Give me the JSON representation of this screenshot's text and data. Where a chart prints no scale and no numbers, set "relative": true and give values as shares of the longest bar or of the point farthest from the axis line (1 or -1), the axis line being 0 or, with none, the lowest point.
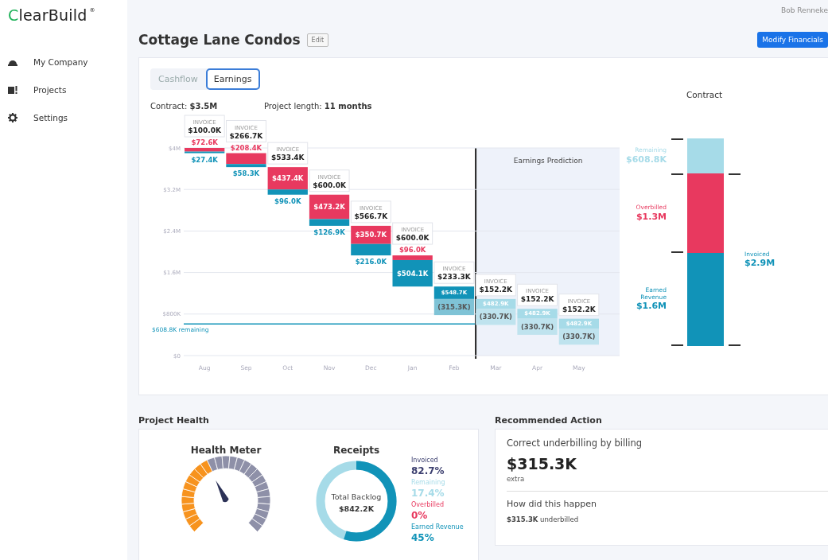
{
  "sidebar": {
    "logo": "ClearBuild",
    "logo_mark": "®",
    "items": [
      {
        "label": "My Company",
        "kind": "helmet"
      },
      {
        "label": "Projects",
        "kind": "alert"
      },
      {
        "label": "Settings",
        "kind": "gear"
      }
    ]
  },
  "header": {
    "user": "Bob Renneke",
    "title": "Cottage Lane Condos",
    "edit": "Edit",
    "action": "Modify Financials"
  },
  "earnings": {
    "tabs": [
      {
        "label": "Cashflow",
        "selected": false
      },
      {
        "label": "Earnings",
        "selected": true
      }
    ],
    "info": [
      "Contract: **$3.5M**",
      "Project length: **11 months**"
    ],
    "waterfall": {
      "y_labels": [
        "$4M",
        "$3.2M",
        "$2.4M",
        "$1.6M",
        "$800K",
        "$0"
      ],
      "prediction_label": "Earnings Prediction",
      "remaining_label": "$608.8K remaining",
      "months": [
        {
          "month": "Aug",
          "kind": "actual",
          "invoice_label": "INVOICE",
          "invoice": "$100.0K",
          "overbilled": "$72.6K",
          "earned": "$27.4K"
        },
        {
          "month": "Sep",
          "kind": "actual",
          "invoice_label": "INVOICE",
          "invoice": "$266.7K",
          "overbilled": "$208.4K",
          "earned": "$58.3K"
        },
        {
          "month": "Oct",
          "kind": "actual",
          "invoice_label": "INVOICE",
          "invoice": "$533.4K",
          "overbilled": "$437.4K",
          "earned": "$96.0K"
        },
        {
          "month": "Nov",
          "kind": "actual",
          "invoice_label": "INVOICE",
          "invoice": "$600.0K",
          "overbilled": "$473.2K",
          "earned": "$126.9K"
        },
        {
          "month": "Dec",
          "kind": "actual",
          "invoice_label": "INVOICE",
          "invoice": "$566.7K",
          "overbilled": "$350.7K",
          "earned": "$216.0K"
        },
        {
          "month": "Jan",
          "kind": "actual",
          "invoice_label": "INVOICE",
          "invoice": "$600.0K",
          "overbilled": "$96.0K",
          "earned": "$504.1K"
        },
        {
          "month": "Feb",
          "kind": "actual",
          "invoice_label": "INVOICE",
          "invoice": "$233.3K",
          "earned": "$548.7K",
          "underbilled": "(315.3K)"
        },
        {
          "month": "Mar",
          "kind": "predicted",
          "invoice_label": "INVOICE",
          "invoice": "$152.2K",
          "earned": "$482.9K",
          "underbilled": "(330.7K)"
        },
        {
          "month": "Apr",
          "kind": "predicted",
          "invoice_label": "INVOICE",
          "invoice": "$152.2K",
          "earned": "$482.9K",
          "underbilled": "(330.7K)"
        },
        {
          "month": "May",
          "kind": "predicted",
          "invoice_label": "INVOICE",
          "invoice": "$152.2K",
          "earned": "$482.9K",
          "underbilled": "(330.7K)"
        }
      ]
    },
    "contract": {
      "chart_data": {
        "type": "bar",
        "stacked": true,
        "relative": true,
        "title": "Contract",
        "series": [
          {
            "name": "Earned Revenue",
            "color": "#1193b8",
            "values": [
              0.45
            ]
          },
          {
            "name": "Overbilled",
            "color": "#e8395f",
            "values": [
              0.38
            ]
          },
          {
            "name": "Remaining",
            "color": "#a6dbe8",
            "values": [
              0.17
            ]
          }
        ],
        "value_labels": [
          [
            "$1.6M"
          ],
          [
            "$1.3M"
          ],
          [
            "$608.8K"
          ]
        ]
      },
      "invoiced": {
        "label": "Invoiced",
        "value": "$2.9M"
      }
    }
  },
  "health": {
    "title": "Project Health",
    "meter": {
      "title": "Health Meter"
    },
    "receipts": {
      "title": "Receipts",
      "center_label": "Total Backlog",
      "center_value": "$842.2K",
      "legend": [
        {
          "label": "Invoiced",
          "value": "82.7%",
          "color": "#3d4070"
        },
        {
          "label": "Remaining",
          "value": "17.4%",
          "color": "#a6dbe8"
        },
        {
          "label": "Overbilled",
          "value": "0%",
          "color": "#e8395f"
        },
        {
          "label": "Earned Revenue",
          "value": "45%",
          "color": "#1193b8"
        }
      ]
    }
  },
  "recommended": {
    "title": "Recommended Action",
    "headline": "Correct underbilling by billing",
    "amount": "$315.3K",
    "amount_note": "extra",
    "question": "How did this happen",
    "answer": "**$315.3K** underbilled"
  }
}
